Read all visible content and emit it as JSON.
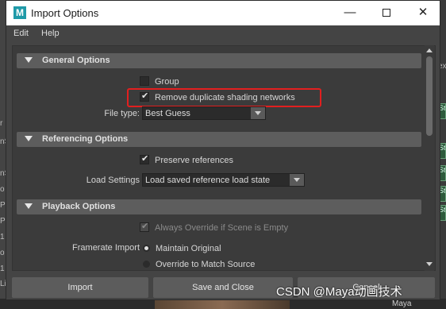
{
  "window": {
    "title": "Import Options",
    "min_glyph": "—",
    "close_glyph": "✕"
  },
  "menu": [
    "Edit",
    "Help"
  ],
  "general": {
    "header": "General Options",
    "group_label": "Group",
    "group_checked": false,
    "remove_dup_label": "Remove duplicate shading networks",
    "remove_dup_checked": true,
    "file_type_label": "File type:",
    "file_type_value": "Best Guess"
  },
  "referencing": {
    "header": "Referencing Options",
    "preserve_label": "Preserve references",
    "preserve_checked": true,
    "load_settings_label": "Load Settings",
    "load_settings_value": "Load saved reference load state"
  },
  "playback": {
    "header": "Playback Options",
    "always_override_label": "Always Override if Scene is Empty",
    "always_override_checked": true,
    "framerate_label": "Framerate Import",
    "radio_maintain": "Maintain Original",
    "radio_override": "Override to Match Source",
    "selected": "Maintain Original"
  },
  "buttons": {
    "import": "Import",
    "save_close": "Save and Close",
    "cancel": "Cancel"
  },
  "background": {
    "left_fragments": [
      "r",
      "nS",
      "nS",
      "o",
      "P",
      "P",
      "1",
      "o",
      "1",
      "Li"
    ],
    "right_tiles": [
      "St",
      "St",
      "St",
      "St",
      "St"
    ],
    "right_top": "ex",
    "bottom_label": "Maya"
  },
  "watermark": "CSDN @Maya动画技术",
  "colors": {
    "highlight": "#e21f1f",
    "window_bg": "#444444",
    "panel_bg": "#3b3b3b",
    "section_bg": "#5d5d5d"
  }
}
